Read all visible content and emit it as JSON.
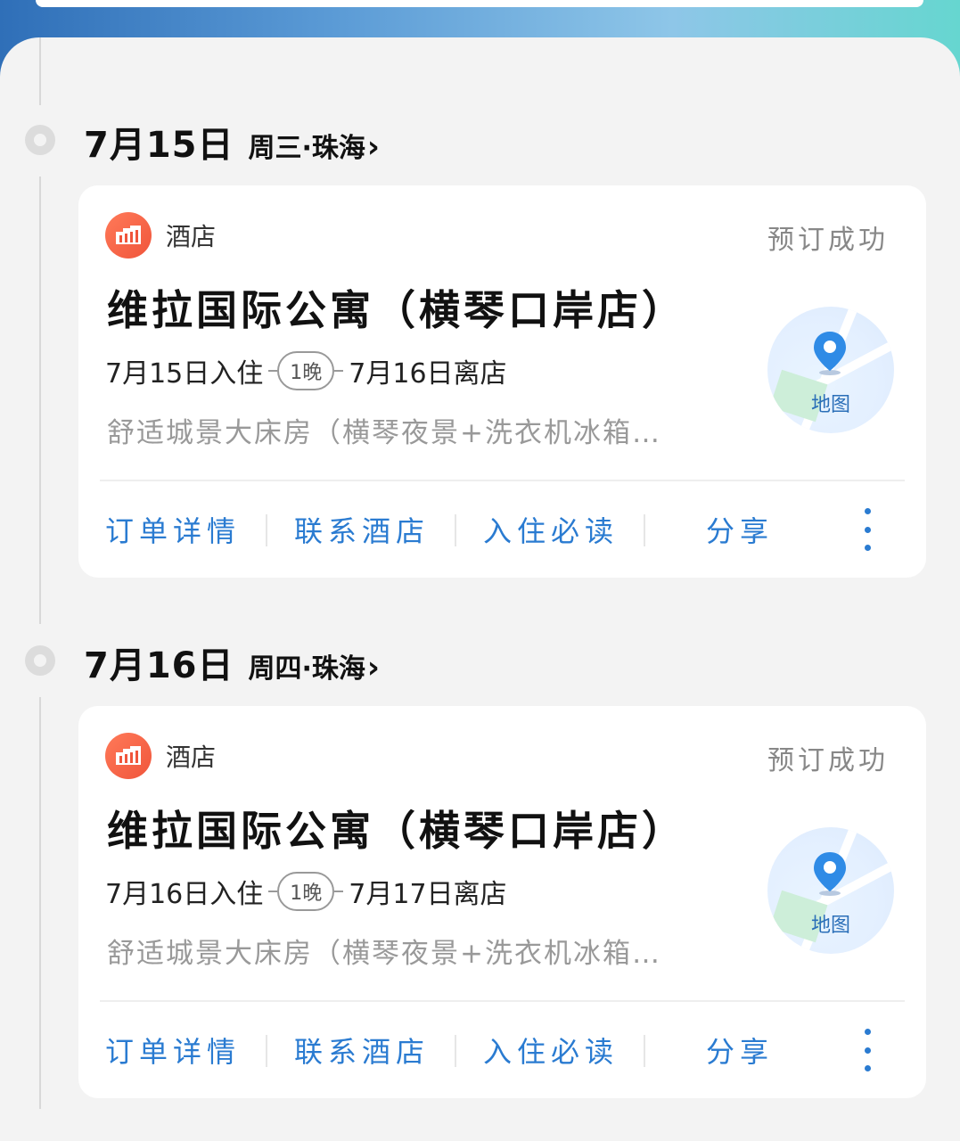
{
  "days": [
    {
      "date": "7月15日",
      "weekday_city": "周三·珠海",
      "card": {
        "category": "酒店",
        "status": "预订成功",
        "hotel_name": "维拉国际公寓（横琴口岸店）",
        "checkin": "7月15日入住",
        "nights": "1晚",
        "checkout": "7月16日离店",
        "room": "舒适城景大床房（横琴夜景+洗衣机冰箱…",
        "map_label": "地图",
        "actions": [
          "订单详情",
          "联系酒店",
          "入住必读",
          "分享"
        ]
      }
    },
    {
      "date": "7月16日",
      "weekday_city": "周四·珠海",
      "card": {
        "category": "酒店",
        "status": "预订成功",
        "hotel_name": "维拉国际公寓（横琴口岸店）",
        "checkin": "7月16日入住",
        "nights": "1晚",
        "checkout": "7月17日离店",
        "room": "舒适城景大床房（横琴夜景+洗衣机冰箱…",
        "map_label": "地图",
        "actions": [
          "订单详情",
          "联系酒店",
          "入住必读",
          "分享"
        ]
      }
    }
  ]
}
